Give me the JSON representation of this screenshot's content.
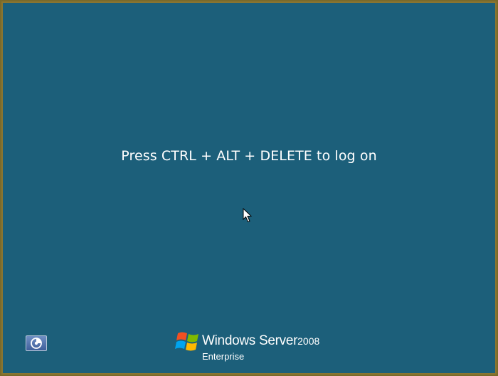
{
  "logon": {
    "prompt": "Press CTRL + ALT + DELETE to log on"
  },
  "ease_of_access": {
    "icon": "ease-of-access-icon"
  },
  "brand": {
    "product_name": "Windows Server",
    "version": "2008",
    "edition": "Enterprise",
    "logo_icon": "windows-flag-icon"
  },
  "colors": {
    "background": "#1c5f7a",
    "frame": "#8a7530",
    "text": "#ffffff"
  }
}
